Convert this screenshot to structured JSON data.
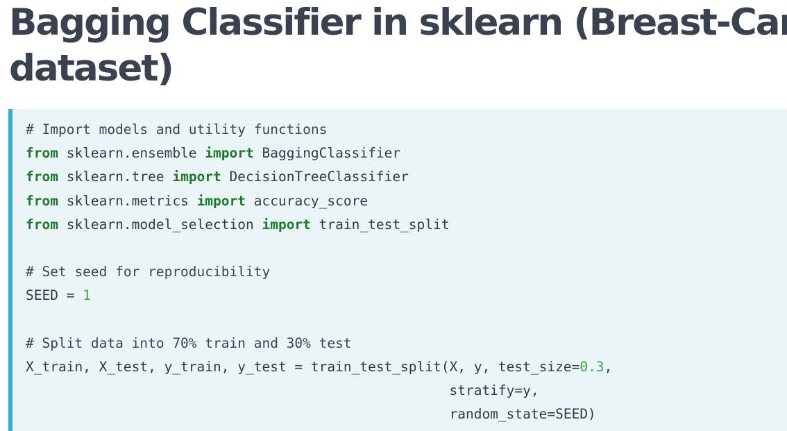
{
  "title": {
    "line1": "Bagging Classifier in sklearn (Breast-Cancer",
    "line2": "dataset)"
  },
  "code": {
    "l1": {
      "comment": "# Import models and utility functions"
    },
    "l2": {
      "kw1": "from",
      "mod": " sklearn.ensemble ",
      "kw2": "import",
      "name": " BaggingClassifier"
    },
    "l3": {
      "kw1": "from",
      "mod": " sklearn.tree ",
      "kw2": "import",
      "name": " DecisionTreeClassifier"
    },
    "l4": {
      "kw1": "from",
      "mod": " sklearn.metrics ",
      "kw2": "import",
      "name": " accuracy_score"
    },
    "l5": {
      "kw1": "from",
      "mod": " sklearn.model_selection ",
      "kw2": "import",
      "name": " train_test_split"
    },
    "l7": {
      "comment": "# Set seed for reproducibility"
    },
    "l8": {
      "pre": "SEED = ",
      "num": "1"
    },
    "l10": {
      "comment": "# Split data into 70% train and 30% test"
    },
    "l11": {
      "pre": "X_train, X_test, y_train, y_test = train_test_split(X, y, test_size=",
      "num": "0.3",
      "post": ","
    },
    "l12": {
      "text": "                                                    stratify=y,"
    },
    "l13": {
      "text": "                                                    random_state=SEED)"
    }
  }
}
